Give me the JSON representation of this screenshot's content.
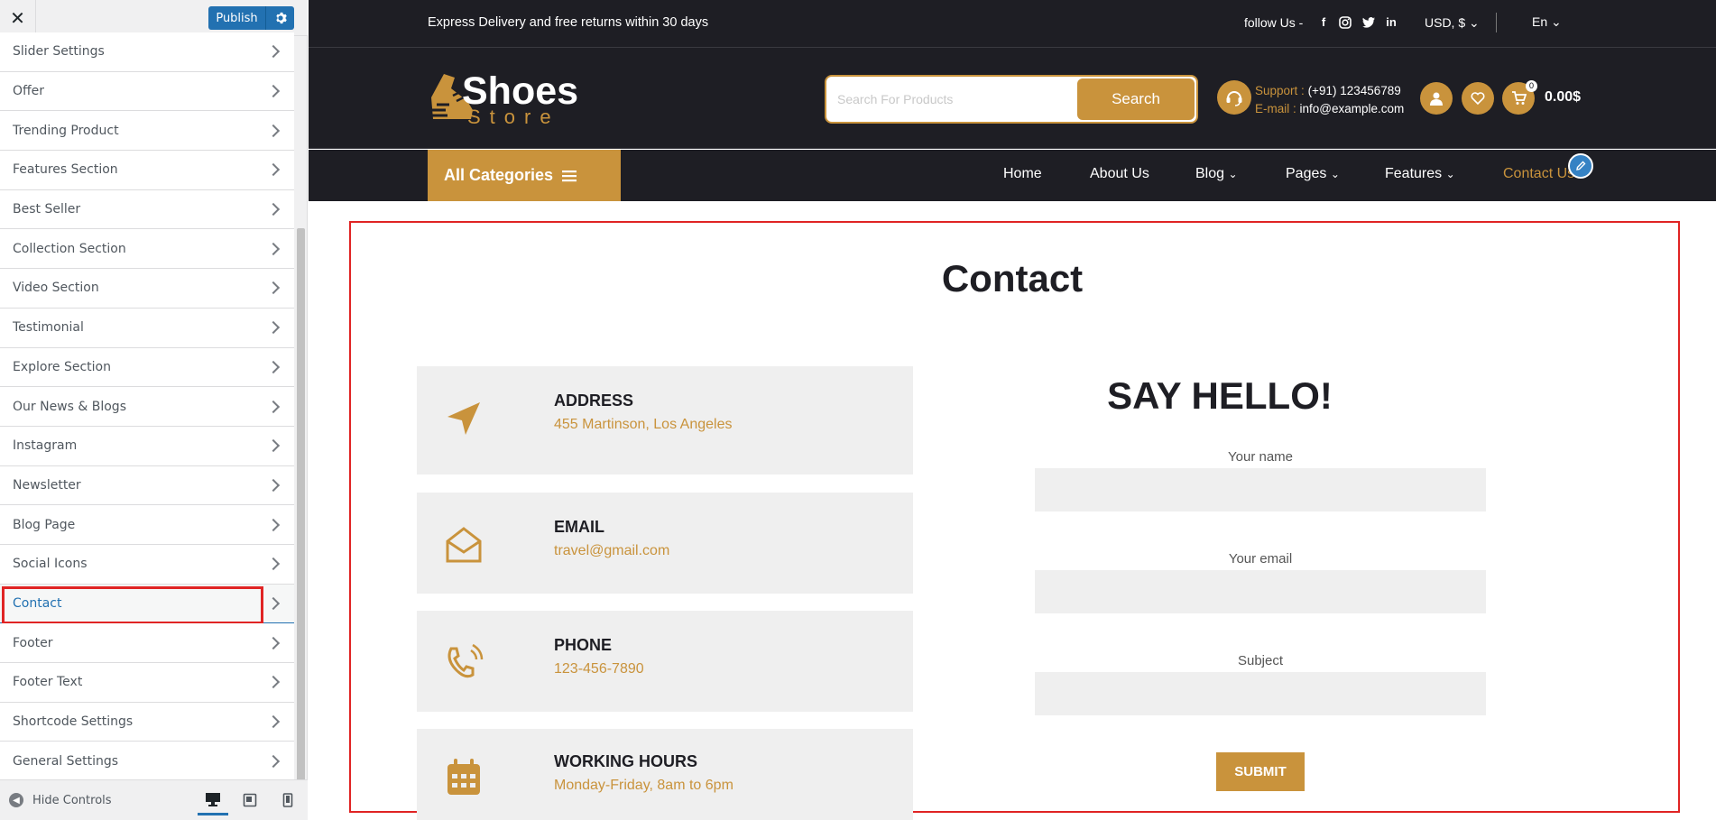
{
  "customizer": {
    "close_icon": "close-icon",
    "publish_label": "Publish",
    "settings_icon": "gear-icon",
    "sections": [
      {
        "label": "Slider Settings"
      },
      {
        "label": "Offer"
      },
      {
        "label": "Trending Product"
      },
      {
        "label": "Features Section"
      },
      {
        "label": "Best Seller"
      },
      {
        "label": "Collection Section"
      },
      {
        "label": "Video Section"
      },
      {
        "label": "Testimonial"
      },
      {
        "label": "Explore Section"
      },
      {
        "label": "Our News & Blogs"
      },
      {
        "label": "Instagram"
      },
      {
        "label": "Newsletter"
      },
      {
        "label": "Blog Page"
      },
      {
        "label": "Social Icons"
      },
      {
        "label": "Contact",
        "active": true
      },
      {
        "label": "Footer"
      },
      {
        "label": "Footer Text"
      },
      {
        "label": "Shortcode Settings"
      },
      {
        "label": "General Settings"
      }
    ],
    "hide_controls": "Hide Controls",
    "devices": [
      "desktop-icon",
      "tablet-icon",
      "mobile-icon"
    ],
    "accent_color": "#2271b1"
  },
  "site": {
    "topbar": {
      "promo": "Express Delivery and free returns within 30 days",
      "follow": "follow Us -",
      "socials": [
        "facebook-icon",
        "instagram-icon",
        "twitter-icon",
        "linkedin-icon"
      ],
      "currency": "USD, $",
      "language": "En"
    },
    "logo": {
      "line1": "Shoes",
      "line2": "Store"
    },
    "search": {
      "placeholder": "Search For Products",
      "button": "Search"
    },
    "support": {
      "support_label": "Support :",
      "support_value": "(+91) 123456789",
      "email_label": "E-mail :",
      "email_value": "info@example.com"
    },
    "cart": {
      "count": "0",
      "total": "0.00$"
    },
    "nav": {
      "all_categories": "All Categories",
      "items": [
        "Home",
        "About Us",
        "Blog",
        "Pages",
        "Features",
        "Contact Us"
      ]
    },
    "brand_color": "#c9933c",
    "dark_color": "#1e1e24"
  },
  "contact": {
    "title": "Contact",
    "cards": [
      {
        "title": "ADDRESS",
        "value": "455 Martinson, Los Angeles",
        "icon": "location-arrow-icon"
      },
      {
        "title": "EMAIL",
        "value": "travel@gmail.com",
        "icon": "envelope-open-icon"
      },
      {
        "title": "PHONE",
        "value": "123-456-7890",
        "icon": "phone-volume-icon"
      },
      {
        "title": "WORKING HOURS",
        "value": "Monday-Friday, 8am to 6pm",
        "icon": "calendar-icon"
      }
    ],
    "form": {
      "heading": "SAY HELLO!",
      "name_label": "Your name",
      "email_label": "Your email",
      "subject_label": "Subject",
      "submit": "SUBMIT"
    }
  }
}
